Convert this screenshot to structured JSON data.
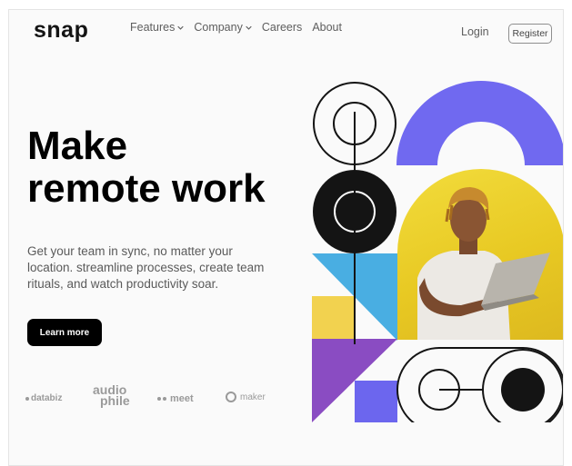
{
  "brand": {
    "logo": "snap"
  },
  "nav": {
    "items": [
      {
        "label": "Features",
        "dropdown": true,
        "icon": "chevron-down-icon"
      },
      {
        "label": "Company",
        "dropdown": true,
        "icon": "chevron-down-icon"
      },
      {
        "label": "Careers",
        "dropdown": false
      },
      {
        "label": "About",
        "dropdown": false
      }
    ],
    "login_label": "Login",
    "register_label": "Register"
  },
  "hero": {
    "headline_line1": "Make",
    "headline_line2": "remote work",
    "description": "Get your team in sync, no matter your location. streamline processes, create team rituals, and watch productivity soar.",
    "cta_label": "Learn more"
  },
  "clients": {
    "databiz": "databiz",
    "audiophile_line1": "audio",
    "audiophile_line2": "phile",
    "meet": "meet",
    "maker": "maker"
  },
  "colors": {
    "accent_purple": "#7069f0",
    "yellow": "#f2d24f",
    "sky_blue": "#49aee2",
    "violet": "#8a4cc2",
    "periwinkle": "#6c66ee",
    "ink": "#141414"
  }
}
